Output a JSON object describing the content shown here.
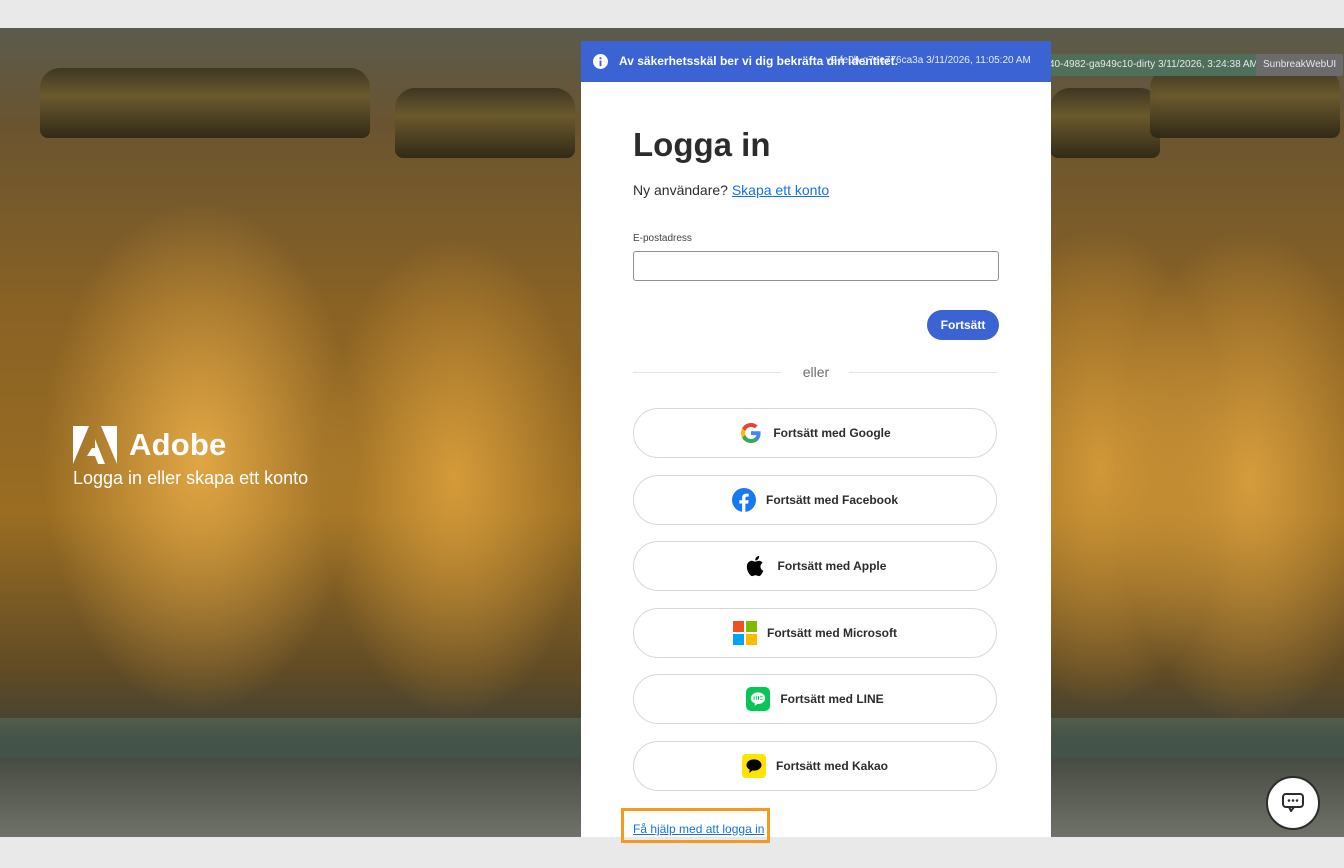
{
  "brand": {
    "name": "Adobe",
    "tagline": "Logga in eller skapa ett konto"
  },
  "build_tags": {
    "tag1": "v40-4982-ga949c10-dirty 3/11/2026, 3:24:38 AM",
    "tag2": "SunbreakWebUI"
  },
  "banner": {
    "text": "Av säkerhetsskäl ber vi dig bekräfta din identitet.",
    "overlay": "v2-fe0b-g7ee776ca3a 3/11/2026, 11:05:20 AM",
    "color": "#3b63d3"
  },
  "login": {
    "title": "Logga in",
    "new_user_prompt": "Ny användare?",
    "create_account_link": "Skapa ett konto",
    "email_label": "E-postadress",
    "email_value": "",
    "continue_label": "Fortsätt",
    "divider": "eller"
  },
  "social": {
    "google": "Fortsätt med Google",
    "facebook": "Fortsätt med Facebook",
    "apple": "Fortsätt med Apple",
    "microsoft": "Fortsätt med Microsoft",
    "line": "Fortsätt med LINE",
    "kakao": "Fortsätt med Kakao"
  },
  "help_link": "Få hjälp med att logga in",
  "colors": {
    "accent": "#3b63d3",
    "link": "#1473e6",
    "highlight": "#f59a1d"
  }
}
